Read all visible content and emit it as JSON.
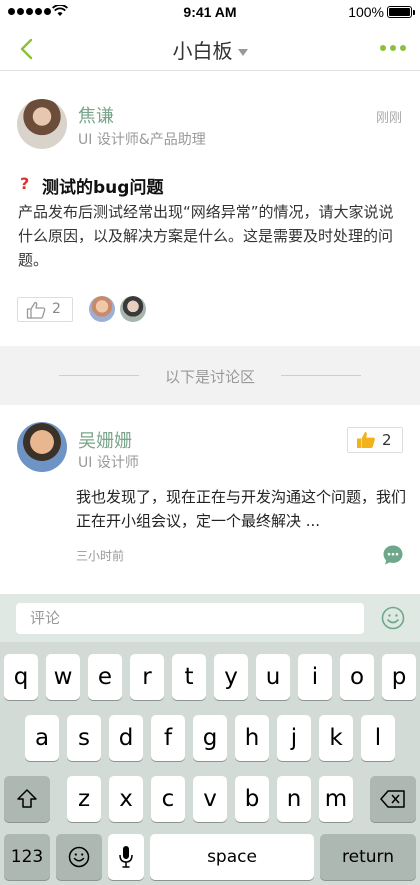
{
  "status_bar": {
    "time": "9:41 AM",
    "battery": "100%"
  },
  "nav": {
    "title": "小白板",
    "back_icon": "chevron-left-icon",
    "more_icon": "more-dots-icon",
    "accent": "#8bbf3c"
  },
  "post": {
    "author": {
      "name": "焦谦",
      "role": "UI 设计师&产品助理"
    },
    "time": "刚刚",
    "title": "测试的bug问题",
    "question_mark": "?",
    "body": "产品发布后测试经常出现“网络异常”的情况，请大家说说什么原因，以及解决方案是什么。这是需要及时处理的问题。",
    "likes": "2"
  },
  "divider": {
    "label": "以下是讨论区"
  },
  "comment": {
    "author": {
      "name": "吴姗姗",
      "role": "UI 设计师"
    },
    "likes": "2",
    "body": "我也发现了，现在正在与开发沟通这个问题，我们正在开小组会议，定一个最终解决 ...",
    "time": "三小时前"
  },
  "input": {
    "placeholder": "评论"
  },
  "keyboard": {
    "row1": [
      "q",
      "w",
      "e",
      "r",
      "t",
      "y",
      "u",
      "i",
      "o",
      "p"
    ],
    "row2": [
      "a",
      "s",
      "d",
      "f",
      "g",
      "h",
      "j",
      "k",
      "l"
    ],
    "row3": [
      "z",
      "x",
      "c",
      "v",
      "b",
      "n",
      "m"
    ],
    "numbers_label": "123",
    "space_label": "space",
    "return_label": "return"
  },
  "colors": {
    "name_green": "#7aa58a",
    "keyboard_bg": "#d3dbd6",
    "input_bar_bg": "#dfe8e3"
  }
}
